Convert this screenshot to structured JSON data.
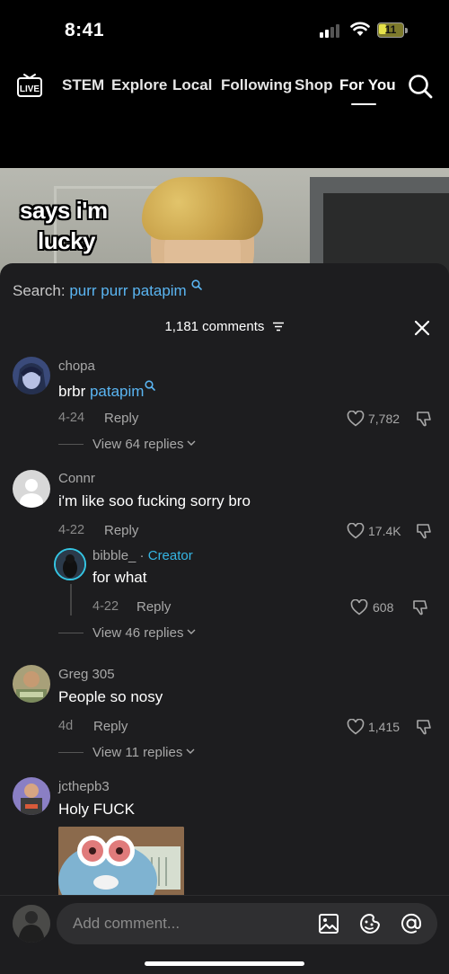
{
  "status_bar": {
    "time": "8:41",
    "battery": "11"
  },
  "top_nav": {
    "live_label": "LIVE",
    "tabs": [
      {
        "label": "STEM"
      },
      {
        "label": "Explore"
      },
      {
        "label": "Local"
      },
      {
        "label": "Following"
      },
      {
        "label": "Shop"
      },
      {
        "label": "For You",
        "active": true
      }
    ]
  },
  "video": {
    "caption_lines": [
      "says i'm",
      "lucky"
    ]
  },
  "sheet": {
    "search_prefix": "Search:",
    "search_query": "purr purr patapim",
    "comments_count": "1,181 comments",
    "reply_label": "Reply",
    "comments": [
      {
        "username": "chopa",
        "text_plain": "brbr ",
        "text_link": "patapim",
        "date": "4-24",
        "likes": "7,782",
        "view_replies": "View 64 replies"
      },
      {
        "username": "Connr",
        "text_plain": "i'm like soo fucking sorry bro",
        "date": "4-22",
        "likes": "17.4K",
        "reply": {
          "username": "bibble_",
          "creator_label": "Creator",
          "text": "for what",
          "date": "4-22",
          "likes": "608"
        },
        "view_replies": "View 46 replies"
      },
      {
        "username": "Greg 305",
        "text_plain": "People so nosy",
        "date": "4d",
        "likes": "1,415",
        "view_replies": "View 11 replies"
      },
      {
        "username": "jcthepb3",
        "text_plain": "Holy FUCK"
      }
    ]
  },
  "composer": {
    "placeholder": "Add comment..."
  },
  "colors": {
    "accent_link": "#5ab5f2",
    "creator": "#35b6e4",
    "sheet_bg": "#1d1d1f"
  }
}
